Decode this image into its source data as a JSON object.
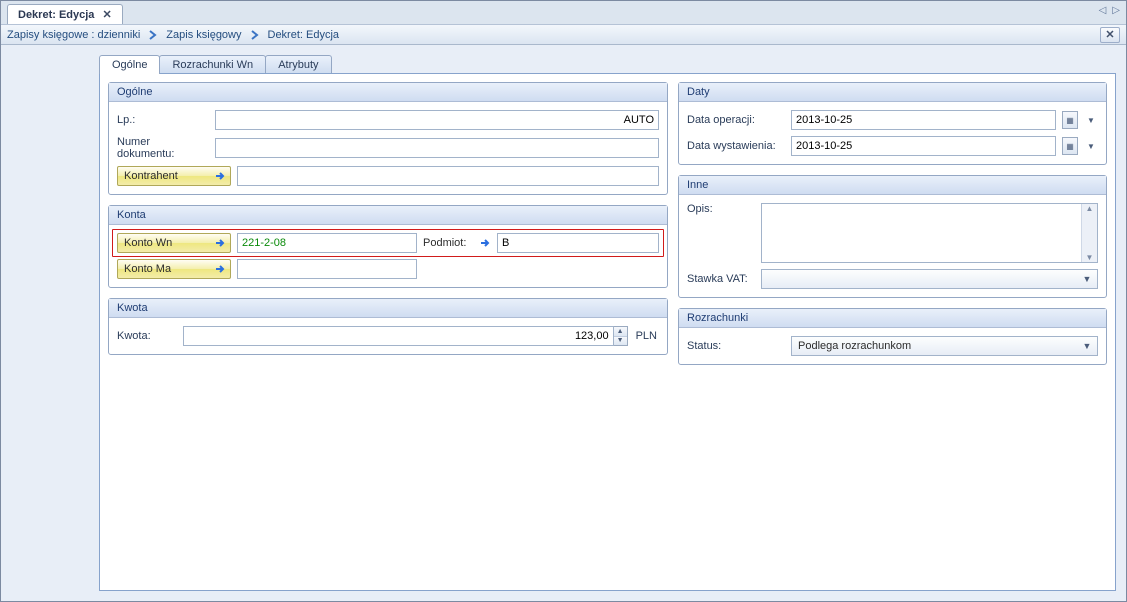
{
  "window": {
    "doc_tab_title": "Dekret: Edycja"
  },
  "breadcrumb": {
    "c1": "Zapisy księgowe : dzienniki",
    "c2": "Zapis księgowy",
    "c3": "Dekret: Edycja"
  },
  "tabs": {
    "t1": "Ogólne",
    "t2": "Rozrachunki Wn",
    "t3": "Atrybuty"
  },
  "gb_ogolne_title": "Ogólne",
  "lbl_lp": "Lp.:",
  "val_lp": "AUTO",
  "lbl_numer_dokumentu": "Numer dokumentu:",
  "val_numer_dokumentu": "",
  "lbl_kontrahent": "Kontrahent",
  "val_kontrahent": "",
  "gb_konta_title": "Konta",
  "lbl_konto_wn": "Konto Wn",
  "val_konto_wn": "221-2-08",
  "lbl_podmiot": "Podmiot:",
  "val_podmiot": "B",
  "lbl_konto_ma": "Konto Ma",
  "val_konto_ma": "",
  "gb_kwota_title": "Kwota",
  "lbl_kwota": "Kwota:",
  "val_kwota": "123,00",
  "lbl_pln": "PLN",
  "gb_daty_title": "Daty",
  "lbl_data_operacji": "Data operacji:",
  "val_data_operacji": "2013-10-25",
  "lbl_data_wystawienia": "Data wystawienia:",
  "val_data_wystawienia": "2013-10-25",
  "gb_inne_title": "Inne",
  "lbl_opis": "Opis:",
  "val_opis": "",
  "lbl_stawka_vat": "Stawka VAT:",
  "val_stawka_vat": "",
  "gb_rozrachunki_title": "Rozrachunki",
  "lbl_status": "Status:",
  "val_status": "Podlega rozrachunkom"
}
